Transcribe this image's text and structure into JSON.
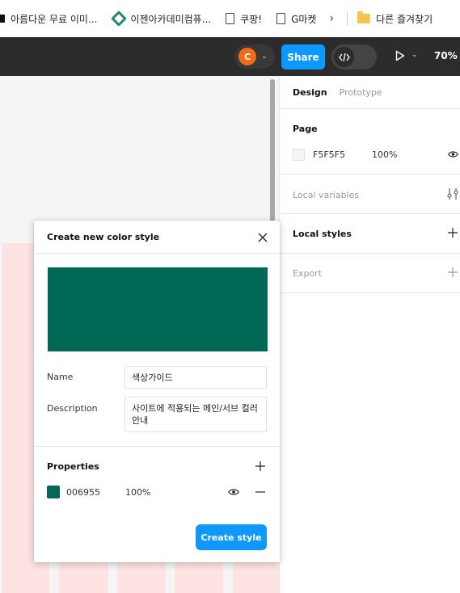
{
  "bookmarks": [
    {
      "label": "아름다운 무료 이미...",
      "icon": "square-icon"
    },
    {
      "label": "이젠아카데미컴퓨...",
      "icon": "academy-logo-icon"
    },
    {
      "label": "쿠팡!",
      "icon": "document-icon"
    },
    {
      "label": "G마켓",
      "icon": "document-icon"
    },
    {
      "label": "다른 즐겨찾기",
      "icon": "folder-icon"
    }
  ],
  "toolbar": {
    "avatar_initial": "C",
    "share_label": "Share",
    "zoom": "70%"
  },
  "panel": {
    "tabs": {
      "design": "Design",
      "prototype": "Prototype"
    },
    "page": {
      "title": "Page",
      "color": "F5F5F5",
      "opacity": "100%"
    },
    "local_variables": "Local variables",
    "local_styles": "Local styles",
    "export": "Export"
  },
  "modal": {
    "title": "Create new color style",
    "name_label": "Name",
    "name_value": "색상가이드",
    "description_label": "Description",
    "description_value": "사이트에 적용되는 메인/서브 컬러 안내",
    "properties_title": "Properties",
    "property": {
      "hex": "006955",
      "opacity": "100%"
    },
    "create_label": "Create style"
  },
  "colors": {
    "style_color": "#006955",
    "accent": "#0d99ff",
    "frame": "#ffe3e3",
    "avatar": "#f26a13"
  }
}
